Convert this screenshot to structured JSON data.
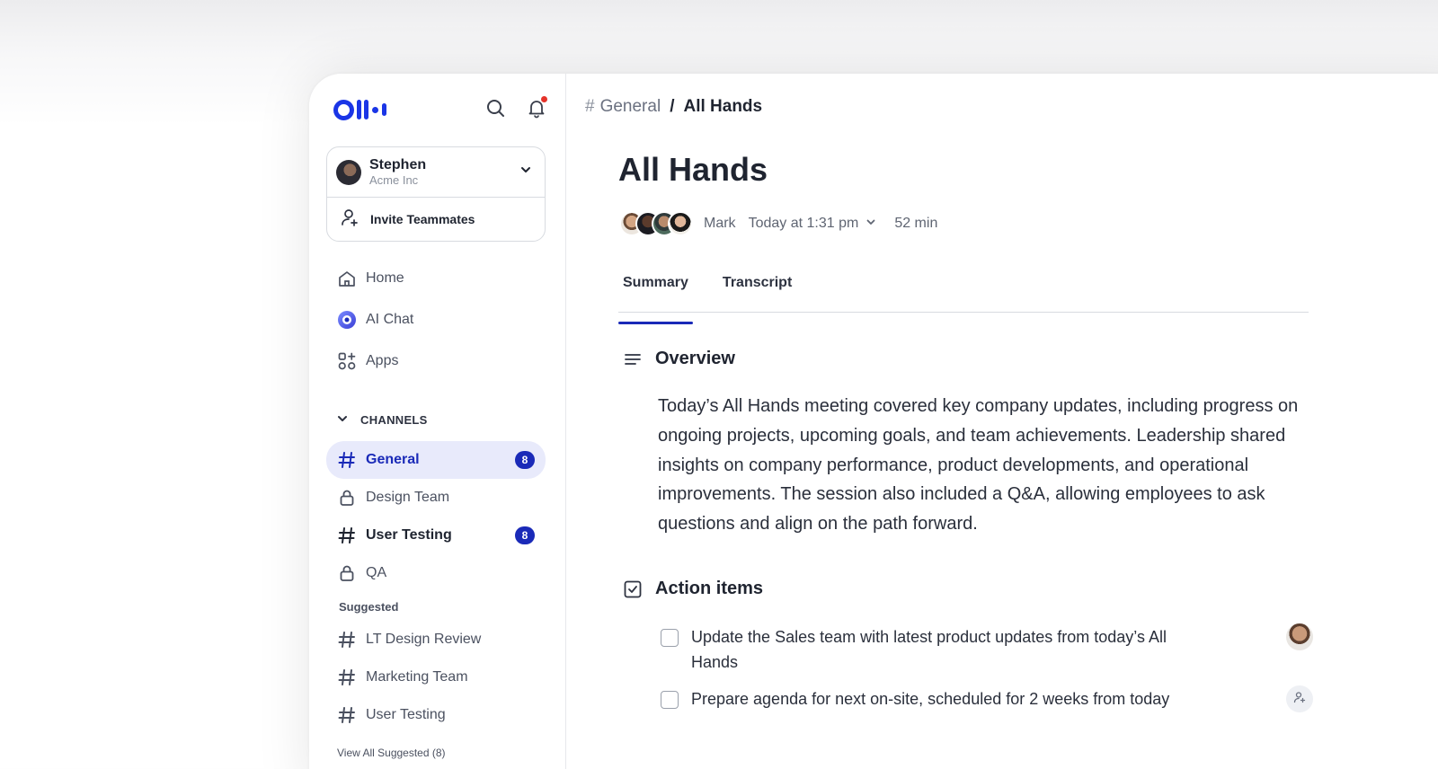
{
  "sidebar": {
    "account": {
      "name": "Stephen",
      "org": "Acme Inc"
    },
    "invite_label": "Invite Teammates",
    "nav": [
      {
        "label": "Home",
        "icon": "home-icon"
      },
      {
        "label": "AI Chat",
        "icon": "ai-chat-icon"
      },
      {
        "label": "Apps",
        "icon": "apps-icon"
      }
    ],
    "channels_heading": "CHANNELS",
    "channels": [
      {
        "label": "General",
        "icon": "hash-icon",
        "badge": "8",
        "active": true
      },
      {
        "label": "Design Team",
        "icon": "lock-icon"
      },
      {
        "label": "User Testing",
        "icon": "hash-icon",
        "badge": "8"
      },
      {
        "label": "QA",
        "icon": "lock-icon"
      }
    ],
    "suggested_heading": "Suggested",
    "suggested": [
      {
        "label": "LT Design Review"
      },
      {
        "label": "Marketing Team"
      },
      {
        "label": "User Testing"
      }
    ],
    "view_all": "View All Suggested (8)"
  },
  "main": {
    "breadcrumb": {
      "hash": "#",
      "channel": "General",
      "separator": "/",
      "current": "All Hands"
    },
    "title": "All Hands",
    "meta": {
      "owner": "Mark",
      "date": "Today at 1:31 pm",
      "duration": "52 min"
    },
    "tabs": [
      {
        "label": "Summary"
      },
      {
        "label": "Transcript"
      }
    ],
    "overview": {
      "heading": "Overview",
      "text": "Today’s All Hands meeting covered key company updates, including progress on ongoing projects, upcoming goals, and team achievements. Leadership shared insights on company performance, product developments, and operational improvements. The session also included a Q&A, allowing employees to ask questions and align on the path forward."
    },
    "action_items": {
      "heading": "Action items",
      "items": [
        {
          "text": "Update the Sales team with latest product updates from today’s All Hands"
        },
        {
          "text": "Prepare agenda for next on-site, scheduled for 2 weeks from today"
        }
      ]
    }
  },
  "colors": {
    "brand": "#1a35e6",
    "accent": "#1a2ab8",
    "active_bg": "#e8eafb",
    "notification": "#e5332a"
  }
}
